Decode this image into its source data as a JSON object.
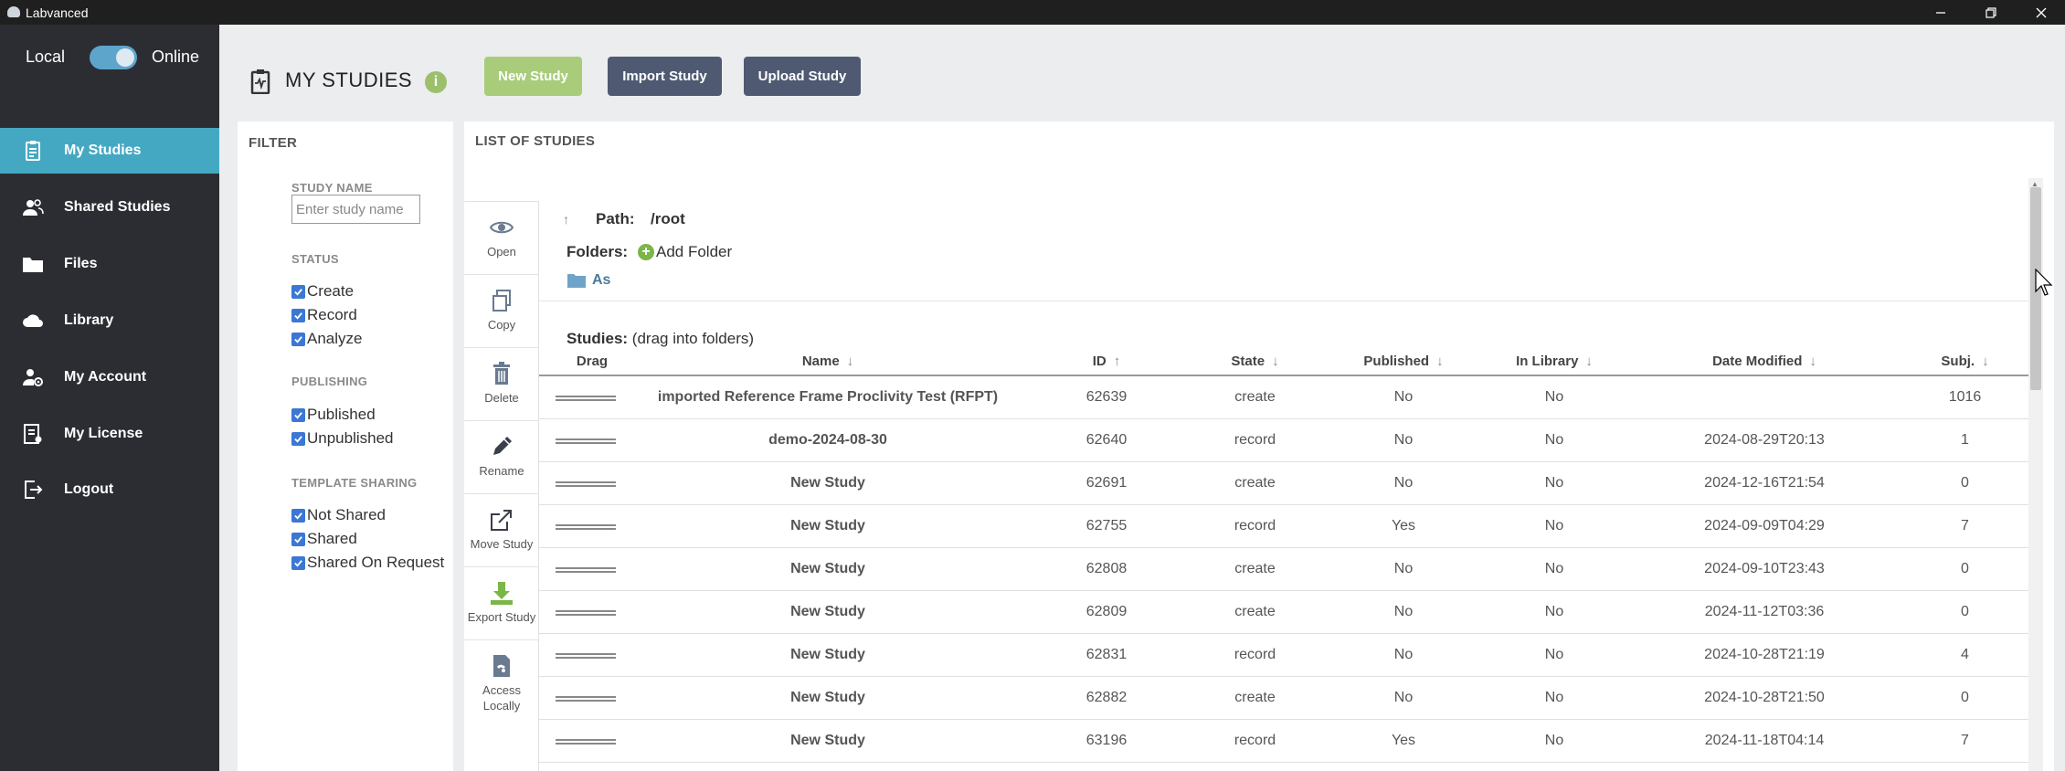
{
  "window": {
    "title": "Labvanced",
    "controls": [
      "minimize",
      "restore",
      "close"
    ]
  },
  "sidebar": {
    "mode_local": "Local",
    "mode_online": "Online",
    "toggle_on": true,
    "items": [
      {
        "label": "My Studies",
        "icon": "clipboard-icon",
        "active": true
      },
      {
        "label": "Shared Studies",
        "icon": "users-icon",
        "active": false
      },
      {
        "label": "Files",
        "icon": "folder-icon",
        "active": false
      },
      {
        "label": "Library",
        "icon": "cloud-icon",
        "active": false
      },
      {
        "label": "My Account",
        "icon": "user-gear-icon",
        "active": false
      },
      {
        "label": "My License",
        "icon": "license-icon",
        "active": false
      },
      {
        "label": "Logout",
        "icon": "logout-icon",
        "active": false
      }
    ],
    "active_color": "#45a8c3"
  },
  "header": {
    "title": "MY STUDIES",
    "info_icon": "i",
    "new_study": "New Study",
    "import_study": "Import Study",
    "upload_study": "Upload Study"
  },
  "filter": {
    "title": "FILTER",
    "study_name_label": "STUDY NAME",
    "study_name_placeholder": "Enter study name",
    "status_label": "STATUS",
    "status_options": [
      "Create",
      "Record",
      "Analyze"
    ],
    "publishing_label": "PUBLISHING",
    "publishing_options": [
      "Published",
      "Unpublished"
    ],
    "template_label": "TEMPLATE SHARING",
    "template_options": [
      "Not Shared",
      "Shared",
      "Shared On Request"
    ]
  },
  "list": {
    "title": "LIST OF STUDIES",
    "tools": [
      {
        "label": "Open",
        "icon": "eye-icon"
      },
      {
        "label": "Copy",
        "icon": "copy-icon"
      },
      {
        "label": "Delete",
        "icon": "trash-icon"
      },
      {
        "label": "Rename",
        "icon": "pencil-icon"
      },
      {
        "label": "Move Study",
        "icon": "move-icon"
      },
      {
        "label": "Export Study",
        "icon": "download-icon"
      },
      {
        "label": "Access Locally",
        "icon": "local-icon"
      }
    ],
    "path_label": "Path:",
    "path_value": "/root",
    "up_arrow": "↑",
    "folders_label": "Folders:",
    "add_folder": "Add Folder",
    "folder_name": "As",
    "studies_label": "Studies:",
    "studies_hint": "(drag into folders)",
    "columns": {
      "drag": "Drag",
      "name": "Name",
      "id": "ID",
      "state": "State",
      "published": "Published",
      "in_library": "In Library",
      "date_modified": "Date Modified",
      "subj": "Subj."
    },
    "sort_icons": {
      "name": "↓",
      "id": "↑",
      "state": "↓",
      "published": "↓",
      "in_library": "↓",
      "date_modified": "↓",
      "subj": "↓"
    },
    "rows": [
      {
        "name": "imported Reference Frame Proclivity Test (RFPT)",
        "id": "62639",
        "state": "create",
        "published": "No",
        "in_library": "No",
        "date": "",
        "subj": "1016"
      },
      {
        "name": "demo-2024-08-30",
        "id": "62640",
        "state": "record",
        "published": "No",
        "in_library": "No",
        "date": "2024-08-29T20:13",
        "subj": "1"
      },
      {
        "name": "New Study",
        "id": "62691",
        "state": "create",
        "published": "No",
        "in_library": "No",
        "date": "2024-12-16T21:54",
        "subj": "0"
      },
      {
        "name": "New Study",
        "id": "62755",
        "state": "record",
        "published": "Yes",
        "in_library": "No",
        "date": "2024-09-09T04:29",
        "subj": "7"
      },
      {
        "name": "New Study",
        "id": "62808",
        "state": "create",
        "published": "No",
        "in_library": "No",
        "date": "2024-09-10T23:43",
        "subj": "0"
      },
      {
        "name": "New Study",
        "id": "62809",
        "state": "create",
        "published": "No",
        "in_library": "No",
        "date": "2024-11-12T03:36",
        "subj": "0"
      },
      {
        "name": "New Study",
        "id": "62831",
        "state": "record",
        "published": "No",
        "in_library": "No",
        "date": "2024-10-28T21:19",
        "subj": "4"
      },
      {
        "name": "New Study",
        "id": "62882",
        "state": "create",
        "published": "No",
        "in_library": "No",
        "date": "2024-10-28T21:50",
        "subj": "0"
      },
      {
        "name": "New Study",
        "id": "63196",
        "state": "record",
        "published": "Yes",
        "in_library": "No",
        "date": "2024-11-18T04:14",
        "subj": "7"
      }
    ]
  }
}
